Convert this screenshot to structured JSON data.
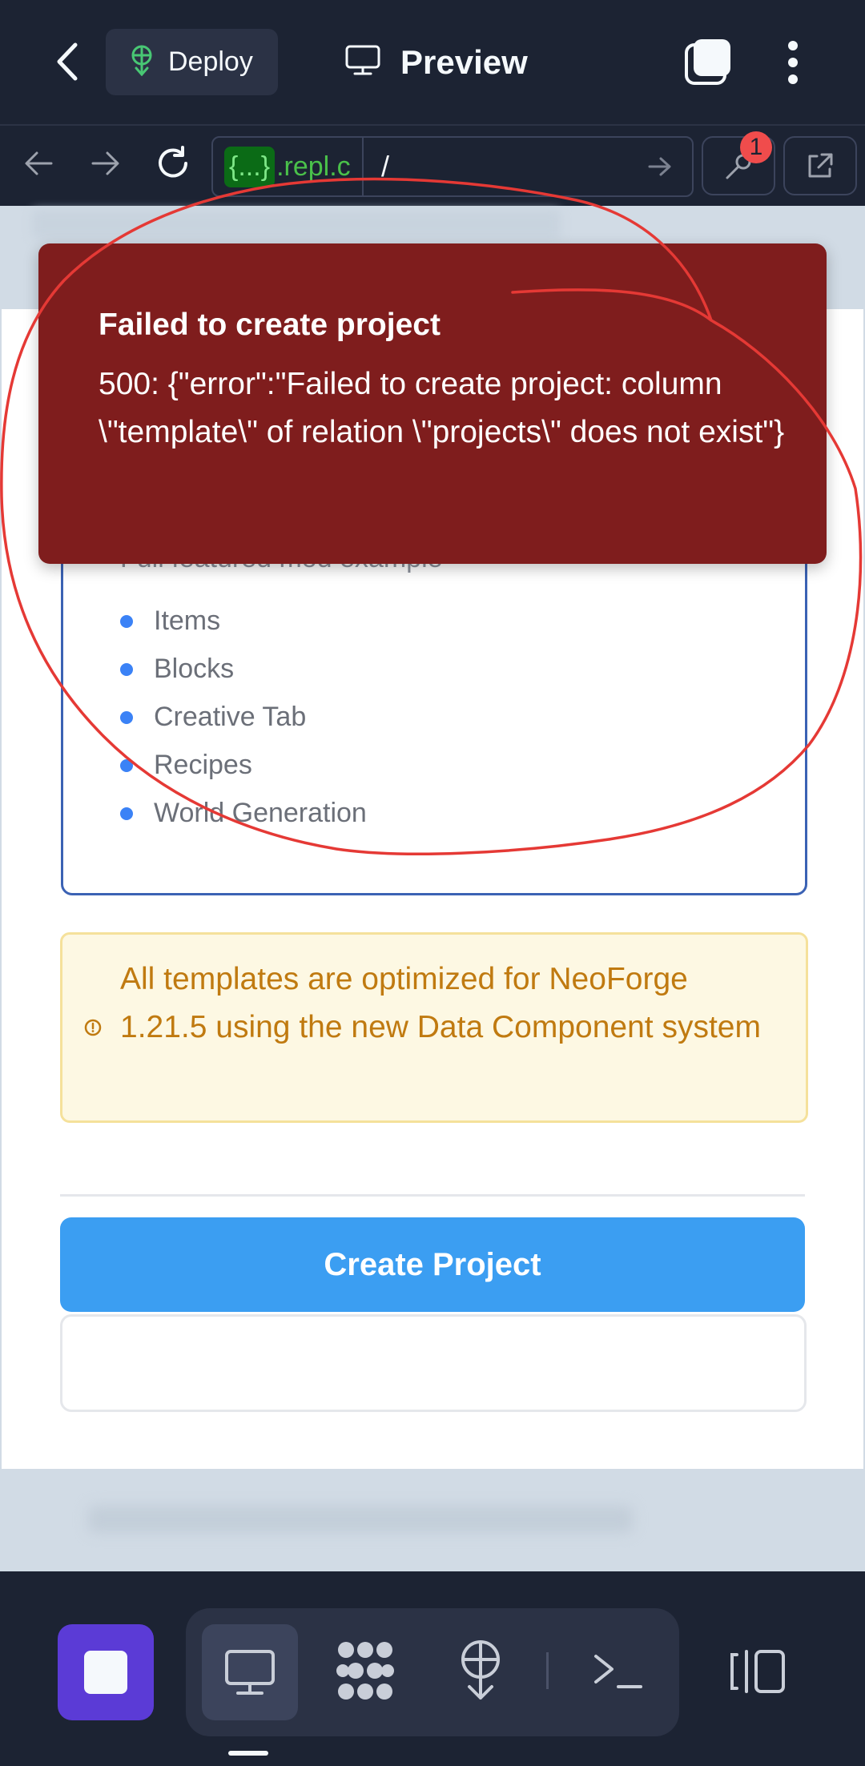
{
  "header": {
    "deploy_label": "Deploy",
    "preview_label": "Preview"
  },
  "urlbar": {
    "chip": "{...}",
    "domain": ".repl.c",
    "path": "/",
    "devtools_badge": "1"
  },
  "template": {
    "description": "Full featured mod example",
    "features": [
      "Items",
      "Blocks",
      "Creative Tab",
      "Recipes",
      "World Generation"
    ]
  },
  "notice": {
    "text": "All templates are optimized for NeoForge 1.21.5 using the new Data Component system"
  },
  "actions": {
    "create_label": "Create Project"
  },
  "toast": {
    "title": "Failed to create project",
    "message": "500: {\"error\":\"Failed to create project: column \\\"template\\\" of relation \\\"projects\\\" does not exist\"}"
  },
  "colors": {
    "toast_bg": "#7f1d1d",
    "primary": "#3b9ef2",
    "stop_button": "#5b3bd6",
    "annotation_stroke": "#e53935"
  },
  "icons": [
    "back-chevron-icon",
    "deploy-icon",
    "monitor-icon",
    "tabs-icon",
    "more-vertical-icon",
    "arrow-left-icon",
    "arrow-right-icon",
    "reload-icon",
    "go-arrow-icon",
    "devtools-wrench-icon",
    "open-external-icon",
    "stop-icon",
    "preview-monitor-icon",
    "packages-icon",
    "deploy-tool-icon",
    "shell-icon",
    "split-view-icon",
    "warning-circle-icon"
  ]
}
